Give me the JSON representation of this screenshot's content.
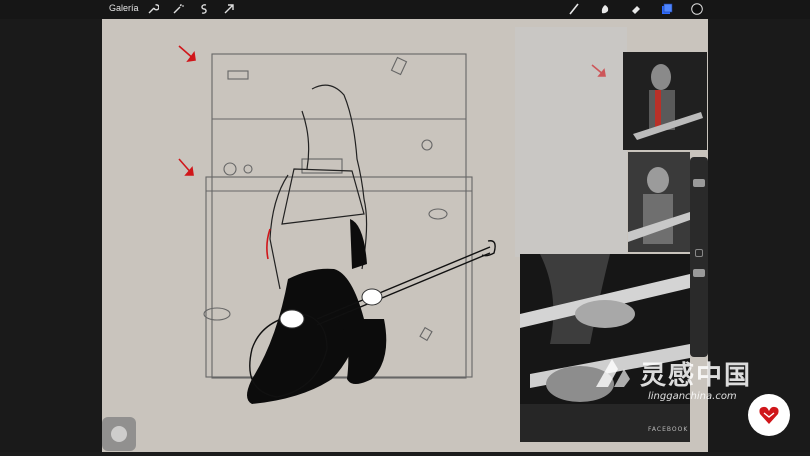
{
  "toolbar": {
    "gallery_label": "Galería",
    "left_tools": [
      "wrench-icon",
      "magic-wand-icon",
      "selection-icon",
      "transform-arrow-icon"
    ],
    "right_tools": [
      "brush-icon",
      "smudge-icon",
      "eraser-icon",
      "layers-icon",
      "color-swatch"
    ]
  },
  "colors": {
    "toolbar_bg": "#161616",
    "canvas_bg": "#c9c4bd",
    "annotation_red": "#d0161a",
    "layers_active": "#2f6bff",
    "badge_red": "#d0161a"
  },
  "watermark": {
    "chinese_text": "灵感中国",
    "url_text": "lingganchina.com"
  },
  "reference_photo_text": "FACEBOOK"
}
